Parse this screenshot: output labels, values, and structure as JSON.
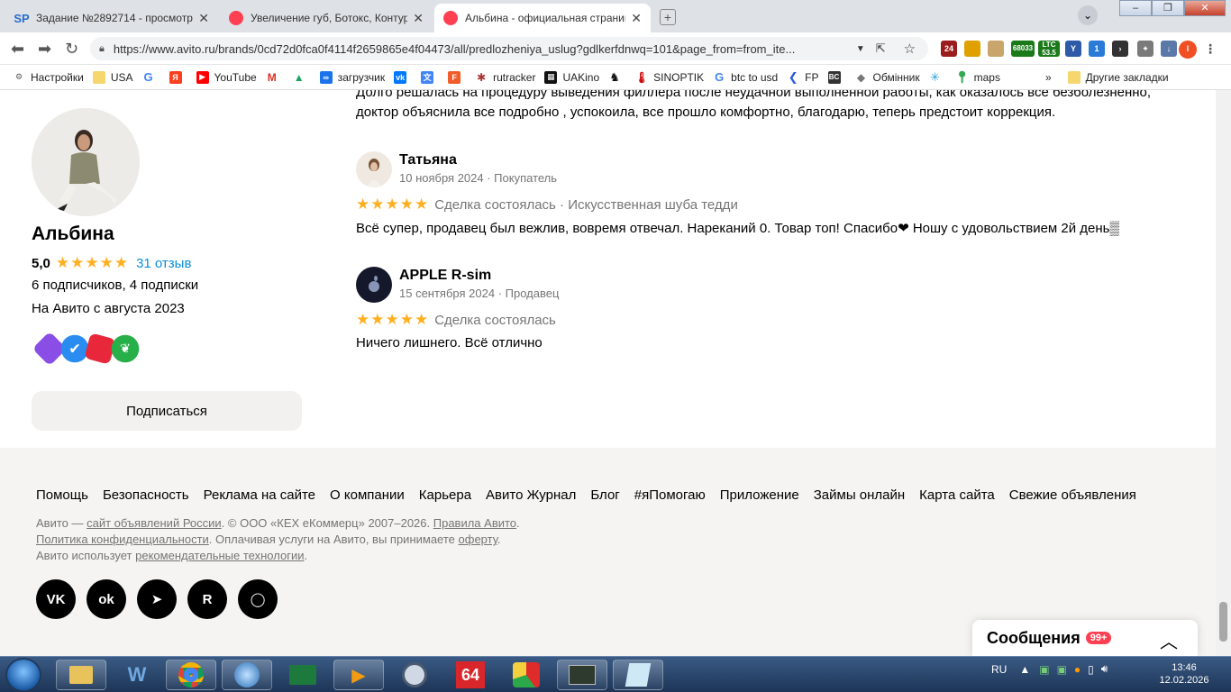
{
  "browser": {
    "tabs": [
      {
        "title": "Задание №2892714 - просмотр з",
        "favicon": "SP",
        "active": false
      },
      {
        "title": "Увеличение губ, Ботокс, Контурн",
        "favicon": "avito-dot",
        "active": false
      },
      {
        "title": "Альбина - официальная страниц",
        "favicon": "avito-dot",
        "active": true
      }
    ],
    "url": "https://www.avito.ru/brands/0cd72d0fca0f4114f2659865e4f04473/all/predlozheniya_uslug?gdlkerfdnwq=101&page_from=from_ite...",
    "profile_letter": "I",
    "ext_badges": {
      "a": "24",
      "b": "68033",
      "c": "LTC",
      "d": "53.5",
      "e": "1"
    },
    "bookmarks": [
      {
        "label": "Настройки",
        "icon": "gear-icon"
      },
      {
        "label": "USA",
        "icon": "folder-icon"
      },
      {
        "label": "",
        "icon": "google-icon"
      },
      {
        "label": "",
        "icon": "yandex-icon"
      },
      {
        "label": "YouTube",
        "icon": "youtube-icon"
      },
      {
        "label": "",
        "icon": "gmail-icon"
      },
      {
        "label": "",
        "icon": "drive-icon"
      },
      {
        "label": "загрузчик",
        "icon": "loader-icon"
      },
      {
        "label": "",
        "icon": "vk-icon"
      },
      {
        "label": "",
        "icon": "translate-icon"
      },
      {
        "label": "",
        "icon": "f-icon"
      },
      {
        "label": "rutracker",
        "icon": "rutracker-icon"
      },
      {
        "label": "UAKino",
        "icon": "uakino-icon"
      },
      {
        "label": "",
        "icon": "chess-icon"
      },
      {
        "label": "SINOPTIK",
        "icon": "thermometer-icon"
      },
      {
        "label": "btc to usd",
        "icon": "google-icon"
      },
      {
        "label": "FP",
        "icon": "fp-icon"
      },
      {
        "label": "",
        "icon": "bc-icon"
      },
      {
        "label": "Обмінник",
        "icon": "exchange-icon"
      },
      {
        "label": "",
        "icon": "star-icon"
      },
      {
        "label": "maps",
        "icon": "maps-icon"
      }
    ],
    "bookmarks_more": "»",
    "other_bookmarks": "Другие закладки"
  },
  "profile": {
    "name": "Альбина",
    "rating": "5,0",
    "reviews_link": "31 отзыв",
    "subscribers": "6 подписчиков, 4 подписки",
    "since": "На Авито с августа 2023",
    "subscribe_button": "Подписаться"
  },
  "reviews": {
    "cut_text_line1": "Долго решалась на процедуру выведения филлера после неудачной выполненной работы, как оказалось все безболезненно,",
    "cut_text_line2": "доктор объяснила все подробно , успокоила, все прошло комфортно, благодарю, теперь предстоит коррекция.",
    "items": [
      {
        "author": "Татьяна",
        "meta": "10 ноября 2024 · Покупатель",
        "deal": "Сделка состоялась · Искусственная шуба тедди",
        "text": "Всё супер, продавец был вежлив, вовремя отвечал. Нареканий 0. Товар топ! Спасибо❤ Ношу с удовольствием 2й день▒"
      },
      {
        "author": "APPLE R-sim",
        "meta": "15 сентября 2024 · Продавец",
        "deal": "Сделка состоялась",
        "text": "Ничего лишнего. Всё отлично"
      }
    ],
    "stars": "★★★★★"
  },
  "footer": {
    "links": [
      "Помощь",
      "Безопасность",
      "Реклама на сайте",
      "О компании",
      "Карьера",
      "Авито Журнал",
      "Блог",
      "#яПомогаю",
      "Приложение",
      "Займы онлайн",
      "Карта сайта",
      "Свежие объявления"
    ],
    "legal_a": "Авито — ",
    "legal_a_link": "сайт объявлений России",
    "legal_b": ". © ООО «КЕХ еКоммерц» 2007–2026. ",
    "legal_b_link": "Правила Авито",
    "legal_c_link": "Политика конфиденциальности",
    "legal_c": ". Оплачивая услуги на Авито, вы принимаете ",
    "legal_c_link2": "оферту",
    "legal_d": "Авито использует ",
    "legal_d_link": "рекомендательные технологии",
    "socials": [
      {
        "name": "vk-icon",
        "glyph": "VK"
      },
      {
        "name": "odnoklassniki-icon",
        "glyph": "ok"
      },
      {
        "name": "telegram-icon",
        "glyph": "➤"
      },
      {
        "name": "rutube-icon",
        "glyph": "R"
      },
      {
        "name": "chat-icon",
        "glyph": "◯"
      }
    ]
  },
  "messages": {
    "title": "Сообщения",
    "count": "99+"
  },
  "taskbar": {
    "lang": "RU",
    "time": "13:46",
    "date": "12.02.2026",
    "tile_label": "64"
  },
  "colors": {
    "star": "#ffb021",
    "link": "#0a8fd6",
    "badge_red": "#ff4053"
  }
}
